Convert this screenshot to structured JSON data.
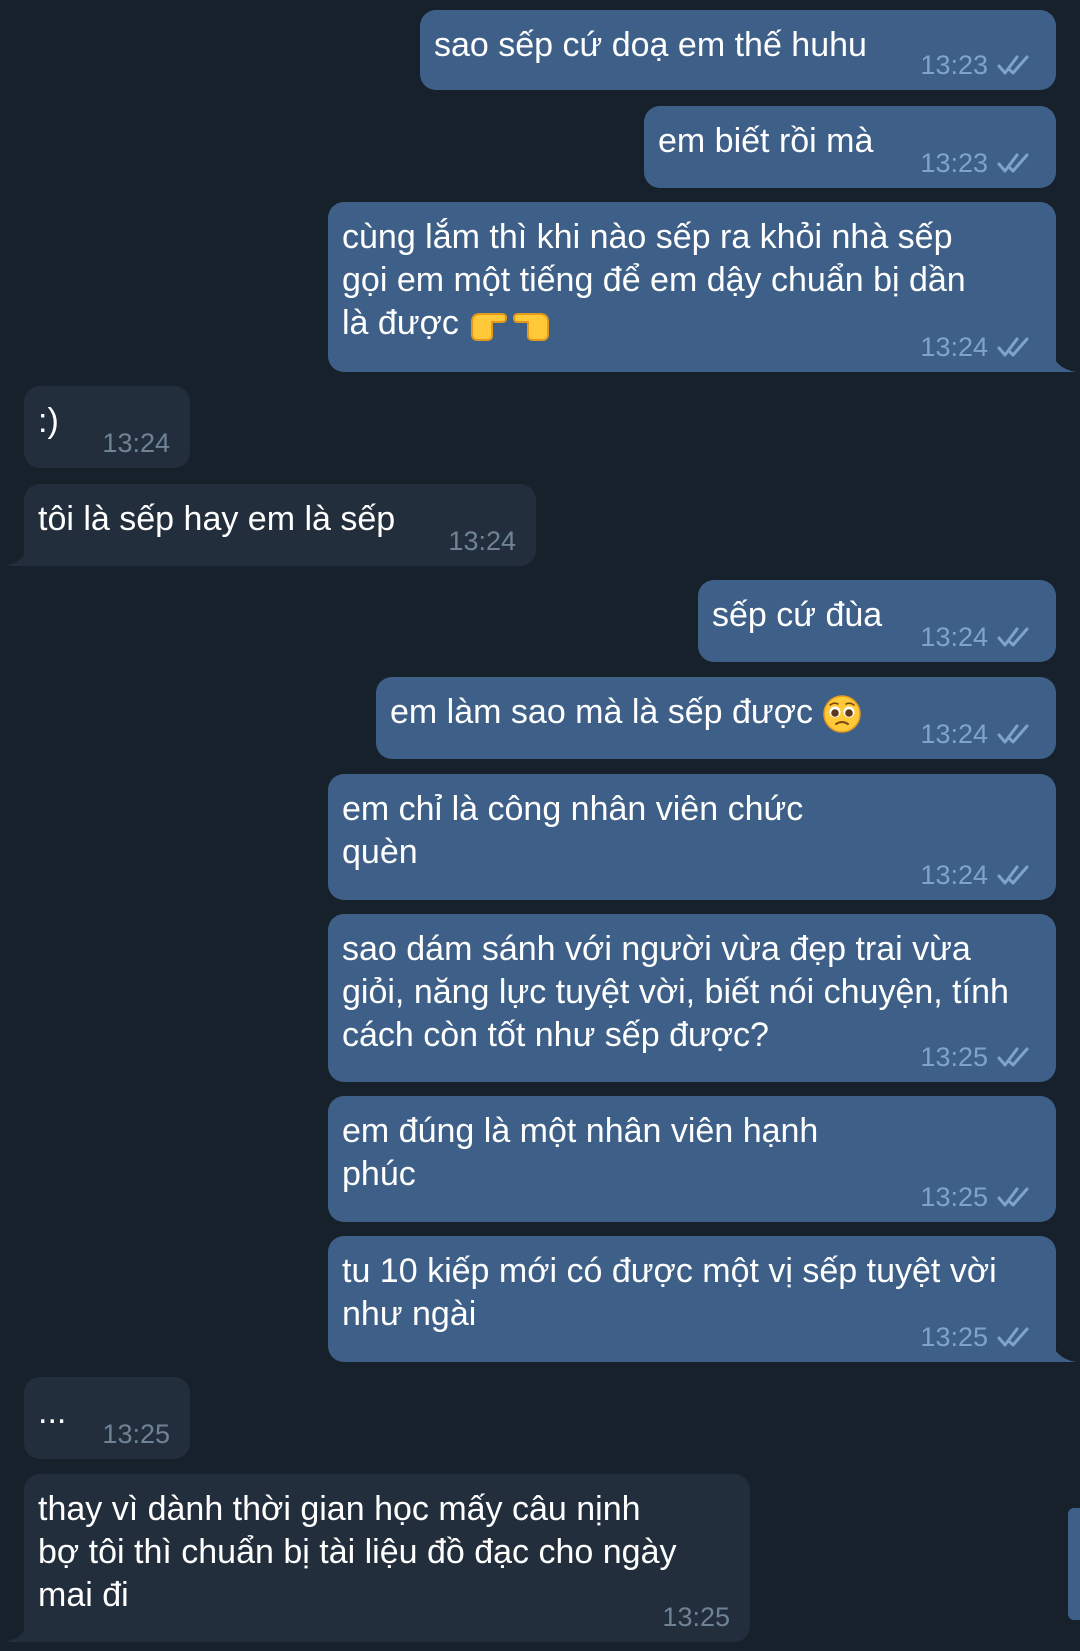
{
  "colors": {
    "background": "#17212b",
    "outgoing_bubble": "#3e6088",
    "incoming_bubble": "#232e3c",
    "outgoing_time": "#7ea4ca",
    "incoming_time": "#6f8397"
  },
  "messages": [
    {
      "direction": "outgoing",
      "text": "sao sếp cứ doạ em thế huhu",
      "time": "13:23",
      "status_icon": "double-check-icon"
    },
    {
      "direction": "outgoing",
      "text": "em biết rồi mà",
      "time": "13:23",
      "status_icon": "double-check-icon"
    },
    {
      "direction": "outgoing",
      "text": "cùng lắm thì khi nào sếp ra khỏi nhà sếp\ngọi em một tiếng để em dậy chuẩn bị dần\nlà được",
      "emoji": "pointing-hands-emoji",
      "time": "13:24",
      "status_icon": "double-check-icon"
    },
    {
      "direction": "incoming",
      "text": ":)",
      "time": "13:24"
    },
    {
      "direction": "incoming",
      "text": "tôi là sếp hay em là sếp",
      "time": "13:24"
    },
    {
      "direction": "outgoing",
      "text": "sếp cứ đùa",
      "time": "13:24",
      "status_icon": "double-check-icon"
    },
    {
      "direction": "outgoing",
      "text": "em làm sao mà là sếp được",
      "emoji": "pleading-face-emoji",
      "time": "13:24",
      "status_icon": "double-check-icon"
    },
    {
      "direction": "outgoing",
      "text": "em chỉ là công nhân viên chức\nquèn",
      "time": "13:24",
      "status_icon": "double-check-icon"
    },
    {
      "direction": "outgoing",
      "text": "sao dám sánh với người vừa đẹp trai vừa\ngiỏi, năng lực tuyệt vời, biết nói chuyện, tính\ncách còn tốt như sếp được?",
      "time": "13:25",
      "status_icon": "double-check-icon"
    },
    {
      "direction": "outgoing",
      "text": "em đúng là một nhân viên hạnh\nphúc",
      "time": "13:25",
      "status_icon": "double-check-icon"
    },
    {
      "direction": "outgoing",
      "text": "tu 10 kiếp mới có được một vị sếp tuyệt vời\nnhư ngài",
      "time": "13:25",
      "status_icon": "double-check-icon"
    },
    {
      "direction": "incoming",
      "text": "...",
      "time": "13:25"
    },
    {
      "direction": "incoming",
      "text": "thay vì dành thời gian học mấy câu nịnh\nbợ tôi thì chuẩn bị tài liệu đồ đạc cho ngày\nmai đi",
      "time": "13:25"
    }
  ]
}
